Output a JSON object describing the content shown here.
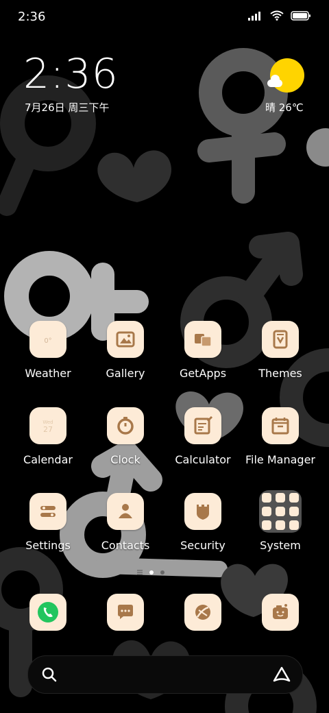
{
  "status_bar": {
    "time": "2:36"
  },
  "clock_widget": {
    "time": "2:36",
    "date": "7月26日 周三下午"
  },
  "weather_widget": {
    "text": "晴 26℃"
  },
  "apps": [
    {
      "label": "Weather",
      "icon": "weather-icon"
    },
    {
      "label": "Gallery",
      "icon": "gallery-icon"
    },
    {
      "label": "GetApps",
      "icon": "getapps-icon"
    },
    {
      "label": "Themes",
      "icon": "themes-icon"
    },
    {
      "label": "Calendar",
      "icon": "calendar-icon"
    },
    {
      "label": "Clock",
      "icon": "clock-icon"
    },
    {
      "label": "Calculator",
      "icon": "calculator-icon"
    },
    {
      "label": "File Manager",
      "icon": "file-manager-icon"
    },
    {
      "label": "Settings",
      "icon": "settings-icon"
    },
    {
      "label": "Contacts",
      "icon": "contacts-icon"
    },
    {
      "label": "Security",
      "icon": "security-icon"
    },
    {
      "label": "System",
      "icon": "folder-icon"
    }
  ],
  "dock": [
    {
      "icon": "phone-icon"
    },
    {
      "icon": "messages-icon"
    },
    {
      "icon": "browser-icon"
    },
    {
      "icon": "camera-icon"
    }
  ],
  "page_indicator": {
    "pages": 2,
    "current": 1
  },
  "colors": {
    "tile": "#FDEBD7",
    "icon_brown": "#A8784A",
    "phone_green": "#22C55E",
    "sun": "#FFD400"
  }
}
